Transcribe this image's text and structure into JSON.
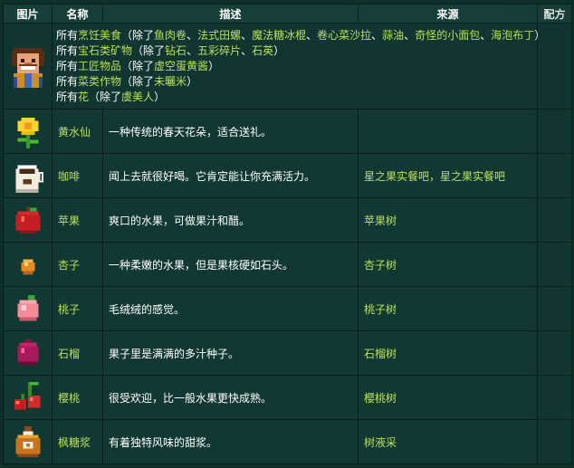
{
  "headers": {
    "image": "图片",
    "name": "名称",
    "description": "描述",
    "source": "来源",
    "recipe": "配方"
  },
  "first_row": {
    "lines": [
      {
        "pre": "所有",
        "hl": "烹饪美食",
        "mid": "（除了",
        "items": [
          "鱼肉卷",
          "法式田螺",
          "魔法糖冰棍",
          "卷心菜沙拉",
          "蒜油",
          "奇怪的小面包",
          "海泡布丁"
        ],
        "post": "）"
      },
      {
        "pre": "所有",
        "hl": "宝石类矿物",
        "mid": "（除了",
        "items": [
          "钻石",
          "五彩碎片",
          "石英"
        ],
        "post": "）"
      },
      {
        "pre": "所有",
        "hl": "工匠物品",
        "mid": "（除了",
        "items": [
          "虚空蛋黄酱"
        ],
        "post": "）"
      },
      {
        "pre": "所有",
        "hl": "菜类作物",
        "mid": "（除了",
        "items": [
          "未曬米"
        ],
        "post": "）"
      },
      {
        "pre": "所有",
        "hl": "花",
        "mid": "（除了",
        "items": [
          "虞美人"
        ],
        "post": "）"
      }
    ]
  },
  "rows": [
    {
      "icon": "daffodil-icon",
      "name": "黄水仙",
      "desc": "一种传统的春天花朵，适合送礼。",
      "source": ""
    },
    {
      "icon": "coffee-icon",
      "name": "咖啡",
      "desc": "闻上去就很好喝。它肯定能让你充满活力。",
      "source": "星之果实餐吧，星之果实餐吧"
    },
    {
      "icon": "apple-icon",
      "name": "苹果",
      "desc": "爽口的水果，可做果汁和醋。",
      "source": "苹果树"
    },
    {
      "icon": "apricot-icon",
      "name": "杏子",
      "desc": "一种柔嫩的水果，但是果核硬如石头。",
      "source": "杏子树"
    },
    {
      "icon": "peach-icon",
      "name": "桃子",
      "desc": "毛绒绒的感觉。",
      "source": "桃子树"
    },
    {
      "icon": "pomegranate-icon",
      "name": "石榴",
      "desc": "果子里是满满的多汁种子。",
      "source": "石榴树"
    },
    {
      "icon": "cherry-icon",
      "name": "樱桃",
      "desc": "很受欢迎，比一般水果更快成熟。",
      "source": "樱桃树"
    },
    {
      "icon": "maple-syrup-icon",
      "name": "枫糖浆",
      "desc": "有着独特风味的甜浆。",
      "source": "树液采"
    }
  ]
}
